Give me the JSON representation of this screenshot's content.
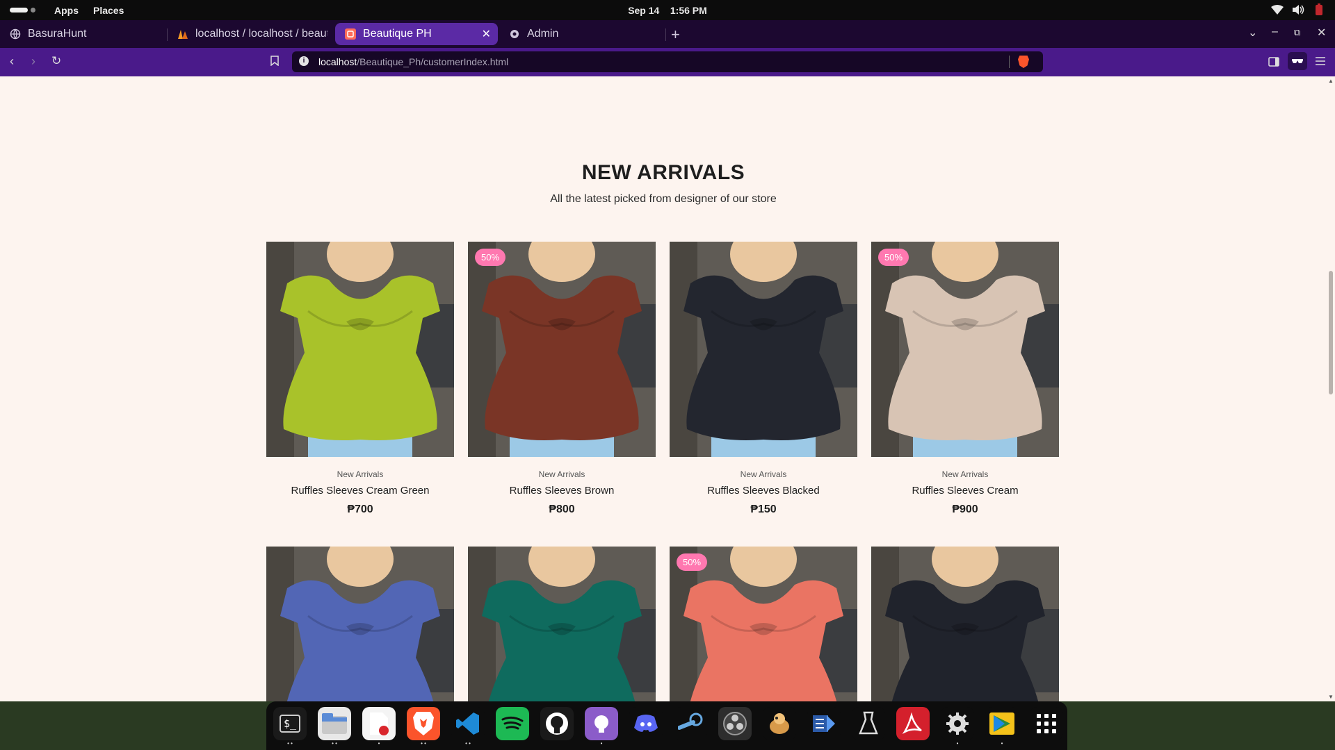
{
  "topbar": {
    "apps": "Apps",
    "places": "Places",
    "date": "Sep 14",
    "time": "1:56 PM"
  },
  "tabs": [
    {
      "label": "BasuraHunt",
      "icon": "globe-icon"
    },
    {
      "label": "localhost / localhost / beauti",
      "icon": "phpmyadmin-icon"
    },
    {
      "label": "Beautique PH",
      "icon": "beautique-icon",
      "active": true
    },
    {
      "label": "Admin",
      "icon": "admin-icon"
    }
  ],
  "address": {
    "host": "localhost",
    "path": "/Beautique_Ph/customerIndex.html"
  },
  "section": {
    "title": "NEW ARRIVALS",
    "subtitle": "All the latest picked from designer of our store"
  },
  "products": [
    {
      "category": "New Arrivals",
      "name": "Ruffles Sleeves Cream Green",
      "price": "₱700",
      "badge": "",
      "color": "#a9c22a"
    },
    {
      "category": "New Arrivals",
      "name": "Ruffles Sleeves Brown",
      "price": "₱800",
      "badge": "50%",
      "color": "#7a3526"
    },
    {
      "category": "New Arrivals",
      "name": "Ruffles Sleeves Blacked",
      "price": "₱150",
      "badge": "",
      "color": "#23262f"
    },
    {
      "category": "New Arrivals",
      "name": "Ruffles Sleeves Cream",
      "price": "₱900",
      "badge": "50%",
      "color": "#d8c4b4"
    },
    {
      "category": "",
      "name": "",
      "price": "",
      "badge": "",
      "color": "#5266b5"
    },
    {
      "category": "",
      "name": "",
      "price": "",
      "badge": "",
      "color": "#0f6b5e"
    },
    {
      "category": "",
      "name": "",
      "price": "",
      "badge": "50%",
      "color": "#ea7463"
    },
    {
      "category": "",
      "name": "",
      "price": "",
      "badge": "",
      "color": "#20232c"
    }
  ],
  "dock": [
    {
      "name": "terminal-icon",
      "bg": "#1a1a1a"
    },
    {
      "name": "files-icon",
      "bg": "#e8e8e8"
    },
    {
      "name": "text-editor-icon",
      "bg": "#f4f4f4"
    },
    {
      "name": "brave-icon",
      "bg": "#fb542b"
    },
    {
      "name": "vscode-icon",
      "bg": "#0d0d0d"
    },
    {
      "name": "spotify-icon",
      "bg": "#1db954"
    },
    {
      "name": "github-icon",
      "bg": "#1a1a1a"
    },
    {
      "name": "github-desktop-icon",
      "bg": "#8b5cc9"
    },
    {
      "name": "discord-icon",
      "bg": "#0d0d0d"
    },
    {
      "name": "steam-icon",
      "bg": "#0d0d0d"
    },
    {
      "name": "obs-icon",
      "bg": "#2d2d2d"
    },
    {
      "name": "game-icon",
      "bg": "#0d0d0d"
    },
    {
      "name": "video-editor-icon",
      "bg": "#0d0d0d"
    },
    {
      "name": "inkscape-icon",
      "bg": "#0d0d0d"
    },
    {
      "name": "pdf-reader-icon",
      "bg": "#d4202c"
    },
    {
      "name": "settings-icon",
      "bg": "#0d0d0d"
    },
    {
      "name": "play-store-icon",
      "bg": "#0d0d0d"
    },
    {
      "name": "app-grid-icon",
      "bg": "#0d0d0d"
    }
  ],
  "colors": {
    "page_bg": "#fdf4ef",
    "badge": "#ff78b0",
    "tab_active": "#5b2aa5",
    "navbar": "#4a1a8a"
  }
}
